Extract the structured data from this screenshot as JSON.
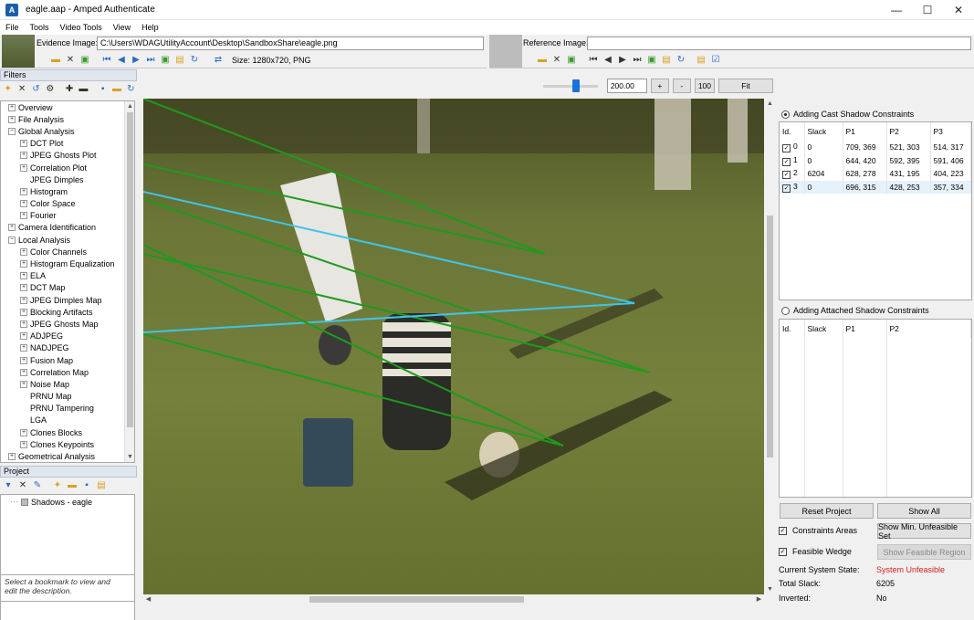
{
  "window": {
    "title": "eagle.aap - Amped Authenticate",
    "logo_letter": "A",
    "minimize": "—",
    "maximize": "☐",
    "close": "✕"
  },
  "menu": [
    "File",
    "Tools",
    "Video Tools",
    "View",
    "Help"
  ],
  "evidence": {
    "label": "Evidence Image:",
    "path": "C:\\Users\\WDAGUtilityAccount\\Desktop\\SandboxShare\\eagle.png",
    "size": "Size: 1280x720, PNG"
  },
  "reference": {
    "label": "Reference Image:",
    "path": ""
  },
  "filters": {
    "header": "Filters",
    "items": [
      {
        "label": "Overview",
        "level": 0,
        "expander": "+"
      },
      {
        "label": "File Analysis",
        "level": 0,
        "expander": "+"
      },
      {
        "label": "Global Analysis",
        "level": 0,
        "expander": "−"
      },
      {
        "label": "DCT Plot",
        "level": 1,
        "expander": "+"
      },
      {
        "label": "JPEG Ghosts Plot",
        "level": 1,
        "expander": "+"
      },
      {
        "label": "Correlation Plot",
        "level": 1,
        "expander": "+"
      },
      {
        "label": "JPEG Dimples",
        "level": 1,
        "expander": ""
      },
      {
        "label": "Histogram",
        "level": 1,
        "expander": "+"
      },
      {
        "label": "Color Space",
        "level": 1,
        "expander": "+"
      },
      {
        "label": "Fourier",
        "level": 1,
        "expander": "+"
      },
      {
        "label": "Camera Identification",
        "level": 0,
        "expander": "+"
      },
      {
        "label": "Local Analysis",
        "level": 0,
        "expander": "−"
      },
      {
        "label": "Color Channels",
        "level": 1,
        "expander": "+"
      },
      {
        "label": "Histogram Equalization",
        "level": 1,
        "expander": "+"
      },
      {
        "label": "ELA",
        "level": 1,
        "expander": "+"
      },
      {
        "label": "DCT Map",
        "level": 1,
        "expander": "+"
      },
      {
        "label": "JPEG Dimples Map",
        "level": 1,
        "expander": "+"
      },
      {
        "label": "Blocking Artifacts",
        "level": 1,
        "expander": "+"
      },
      {
        "label": "JPEG Ghosts Map",
        "level": 1,
        "expander": "+"
      },
      {
        "label": "ADJPEG",
        "level": 1,
        "expander": "+"
      },
      {
        "label": "NADJPEG",
        "level": 1,
        "expander": "+"
      },
      {
        "label": "Fusion Map",
        "level": 1,
        "expander": "+"
      },
      {
        "label": "Correlation Map",
        "level": 1,
        "expander": "+"
      },
      {
        "label": "Noise Map",
        "level": 1,
        "expander": "+"
      },
      {
        "label": "PRNU Map",
        "level": 1,
        "expander": ""
      },
      {
        "label": "PRNU Tampering",
        "level": 1,
        "expander": ""
      },
      {
        "label": "LGA",
        "level": 1,
        "expander": ""
      },
      {
        "label": "Clones Blocks",
        "level": 1,
        "expander": "+"
      },
      {
        "label": "Clones Keypoints",
        "level": 1,
        "expander": "+"
      },
      {
        "label": "Geometrical Analysis",
        "level": 0,
        "expander": "+"
      }
    ]
  },
  "project": {
    "header": "Project",
    "item": "Shadows - eagle",
    "description": "Select a bookmark to view and edit the description."
  },
  "zoom": {
    "value": "200.00",
    "slider_fraction": 0.6,
    "plus": "+",
    "minus": "-",
    "hundred": "100",
    "fit": "Fit"
  },
  "cast": {
    "label": "Adding Cast Shadow Constraints",
    "columns": [
      "Id.",
      "Slack",
      "P1",
      "P2",
      "P3"
    ],
    "rows": [
      {
        "id": "0",
        "slack": "0",
        "p1": "709, 369",
        "p2": "521, 303",
        "p3": "514, 317"
      },
      {
        "id": "1",
        "slack": "0",
        "p1": "644, 420",
        "p2": "592, 395",
        "p3": "591, 406"
      },
      {
        "id": "2",
        "slack": "6204",
        "p1": "628, 278",
        "p2": "431, 195",
        "p3": "404, 223"
      },
      {
        "id": "3",
        "slack": "0",
        "p1": "696, 315",
        "p2": "428, 253",
        "p3": "357, 334"
      }
    ]
  },
  "attached": {
    "label": "Adding Attached Shadow Constraints",
    "columns": [
      "Id.",
      "Slack",
      "P1",
      "P2"
    ]
  },
  "buttons": {
    "reset": "Reset Project",
    "show_all": "Show All",
    "constraints_areas": "Constraints Areas",
    "show_min": "Show Min. Unfeasible Set",
    "feasible_wedge": "Feasible Wedge",
    "show_feasible": "Show Feasible Region"
  },
  "status": {
    "state_label": "Current System State:",
    "state_value": "System Unfeasible",
    "slack_label": "Total Slack:",
    "slack_value": "6205",
    "inverted_label": "Inverted:",
    "inverted_value": "No"
  },
  "colors": {
    "green_line": "#1e9a1e",
    "cyan_line": "#3fc4e8",
    "unfeasible": "#d42020"
  }
}
